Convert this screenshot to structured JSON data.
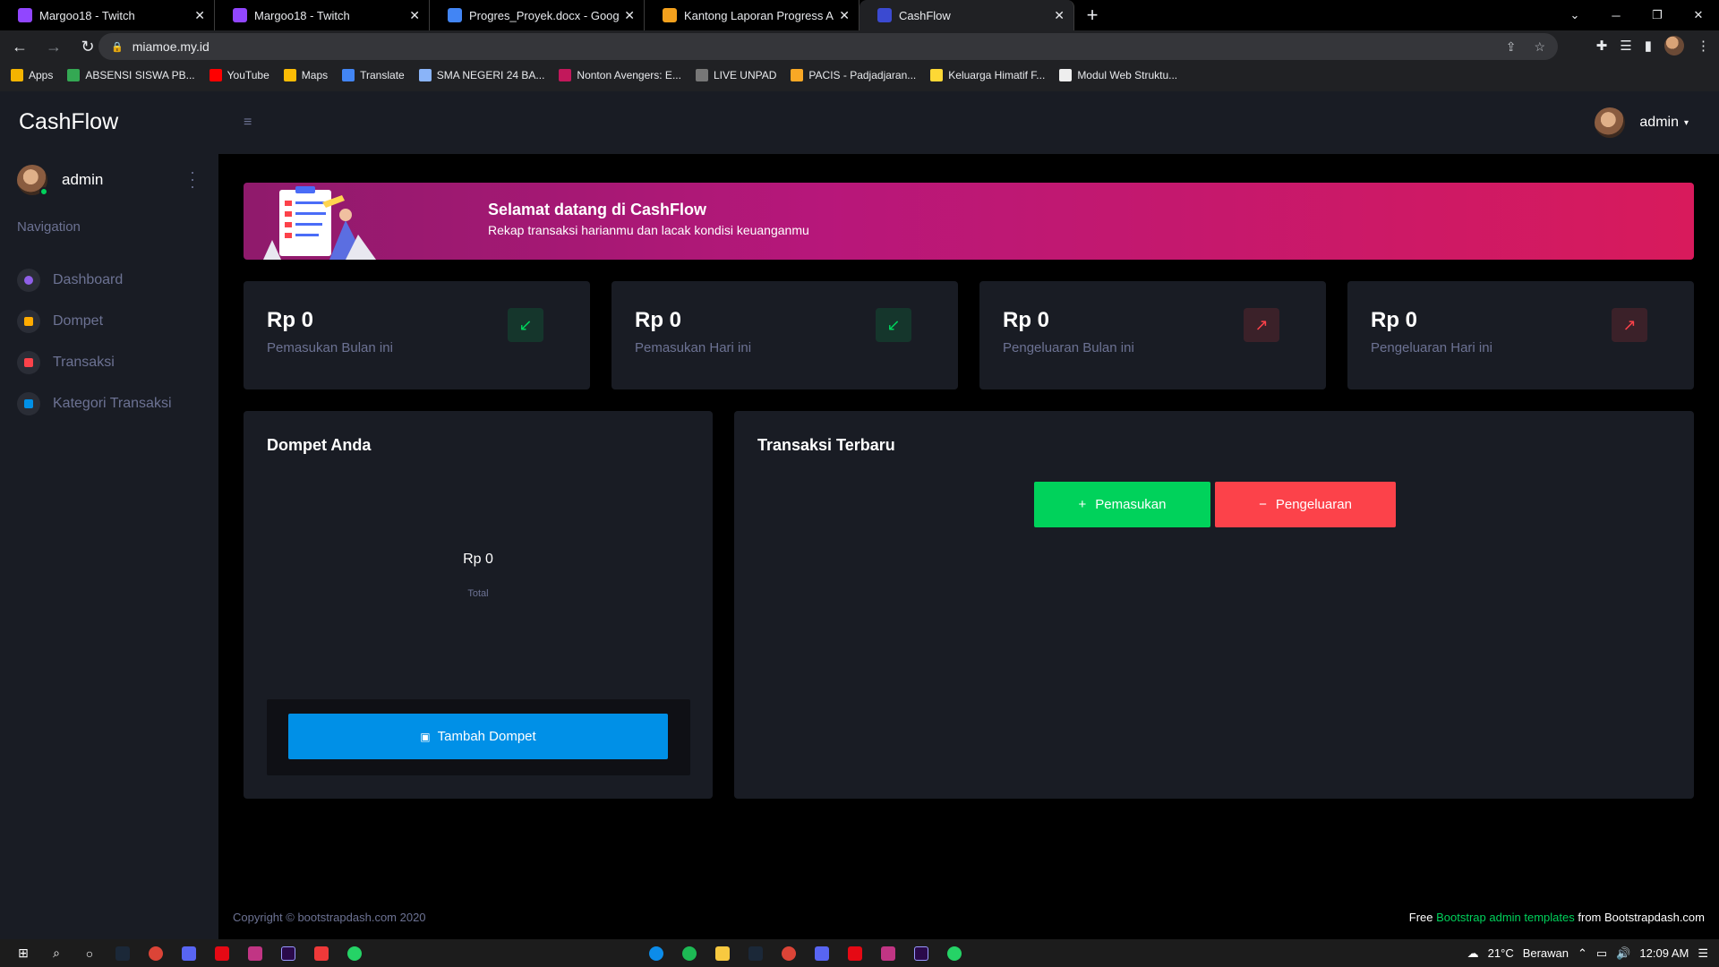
{
  "browser": {
    "tabs": [
      {
        "title": "Margoo18 - Twitch",
        "color": "#9146ff"
      },
      {
        "title": "Margoo18 - Twitch",
        "color": "#9146ff"
      },
      {
        "title": "Progres_Proyek.docx - Google Do",
        "color": "#4285f4"
      },
      {
        "title": "Kantong Laporan Progress Aplikasi",
        "color": "#f4a11d"
      },
      {
        "title": "CashFlow",
        "color": "#3b4ad1"
      }
    ],
    "url": "miamoe.my.id",
    "bookmarks": [
      {
        "label": "Apps",
        "color": "#f4b400"
      },
      {
        "label": "ABSENSI SISWA PB...",
        "color": "#34a853"
      },
      {
        "label": "YouTube",
        "color": "#ff0000"
      },
      {
        "label": "Maps",
        "color": "#fbbc05"
      },
      {
        "label": "Translate",
        "color": "#4285f4"
      },
      {
        "label": "SMA NEGERI 24 BA...",
        "color": "#8ab4f8"
      },
      {
        "label": "Nonton Avengers: E...",
        "color": "#c2185b"
      },
      {
        "label": "LIVE UNPAD",
        "color": "#777777"
      },
      {
        "label": "PACIS - Padjadjaran...",
        "color": "#f9a825"
      },
      {
        "label": "Keluarga Himatif F...",
        "color": "#fdd835"
      },
      {
        "label": "Modul Web Struktu...",
        "color": "#eeeeee"
      }
    ]
  },
  "sidebar": {
    "brand": "CashFlow",
    "user": "admin",
    "nav_label": "Navigation",
    "items": [
      {
        "label": "Dashboard",
        "icon": "speedometer-icon",
        "color": "#8f5fe8"
      },
      {
        "label": "Dompet",
        "icon": "wallet-icon",
        "color": "#ffab00"
      },
      {
        "label": "Transaksi",
        "icon": "table-icon",
        "color": "#fc424a"
      },
      {
        "label": "Kategori Transaksi",
        "icon": "category-icon",
        "color": "#0090e7"
      }
    ]
  },
  "topbar": {
    "user": "admin"
  },
  "banner": {
    "title": "Selamat datang di CashFlow",
    "subtitle": "Rekap transaksi harianmu dan lacak kondisi keuanganmu"
  },
  "stats": [
    {
      "value": "Rp 0",
      "label": "Pemasukan Bulan ini",
      "icon": "arrow-bottom-left-icon",
      "trend": "up"
    },
    {
      "value": "Rp 0",
      "label": "Pemasukan Hari ini",
      "icon": "arrow-bottom-left-icon",
      "trend": "up"
    },
    {
      "value": "Rp 0",
      "label": "Pengeluaran Bulan ini",
      "icon": "arrow-top-right-icon",
      "trend": "down"
    },
    {
      "value": "Rp 0",
      "label": "Pengeluaran Hari ini",
      "icon": "arrow-top-right-icon",
      "trend": "down"
    }
  ],
  "wallet": {
    "title": "Dompet Anda",
    "total": "Rp 0",
    "total_label": "Total",
    "add_button": "Tambah Dompet"
  },
  "transactions": {
    "title": "Transaksi Terbaru",
    "income_button": "Pemasukan",
    "expense_button": "Pengeluaran"
  },
  "footer": {
    "copyright": "Copyright © bootstrapdash.com 2020",
    "free": "Free",
    "link": "Bootstrap admin templates",
    "from": "from Bootstrapdash.com"
  },
  "taskbar": {
    "weather": "21°C",
    "weather_desc": "Berawan",
    "time": "12:09 AM"
  },
  "colors": {
    "success": "#00d25b",
    "danger": "#fc424a",
    "primary": "#0090e7",
    "card": "#191c24"
  }
}
